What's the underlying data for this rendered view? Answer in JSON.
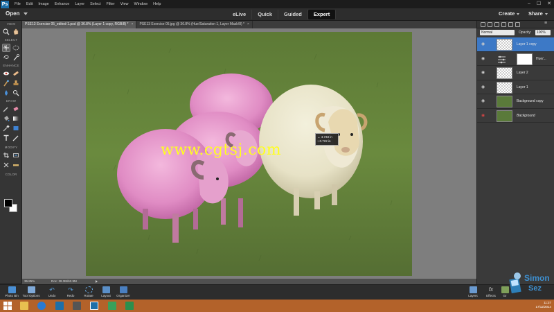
{
  "menubar": {
    "logo": "Ps",
    "items": [
      "File",
      "Edit",
      "Image",
      "Enhance",
      "Layer",
      "Select",
      "Filter",
      "View",
      "Window",
      "Help"
    ],
    "window_controls": [
      "–",
      "☐",
      "✕"
    ]
  },
  "modebar": {
    "open_label": "Open",
    "tabs": [
      "eLive",
      "Quick",
      "Guided",
      "Expert"
    ],
    "active_tab": "Expert",
    "create_label": "Create",
    "share_label": "Share"
  },
  "toolbox": {
    "sections": [
      "VIEW",
      "SELECT",
      "ENHANCE",
      "DRAW",
      "MODIFY",
      "COLOR"
    ],
    "tools": [
      "zoom",
      "hand",
      "move",
      "lasso",
      "magic-wand",
      "quick-selection",
      "eye",
      "spot-healing",
      "smart-brush",
      "blur",
      "sponge",
      "brush",
      "eraser",
      "paint-bucket",
      "gradient",
      "eyedropper",
      "rectangle",
      "type",
      "pencil",
      "crop",
      "recompose",
      "content-aware-move",
      "straighten"
    ],
    "foreground_color": "#000000",
    "background_color": "#ffffff"
  },
  "documents": {
    "tabs": [
      {
        "title": "PSE13 Exercise 05_edited-1.psd @ 36.8% (Layer 1 copy, RGB/8) *",
        "active": true
      },
      {
        "title": "PSE13 Exercise 05.jpg @ 36.8% (Hue/Saturation 1, Layer Mask/8) *",
        "active": false
      }
    ]
  },
  "canvas": {
    "watermark": "www.cgtsj.com",
    "measure_x": "↔ 4.733 in",
    "measure_y": "↕ 0.722 in"
  },
  "status": {
    "zoom": "36.85%",
    "doc": "Doc: 28.3M/62.9M"
  },
  "layers_panel": {
    "blend_mode": "Normal",
    "opacity_label": "Opacity:",
    "opacity_value": "100%",
    "layers": [
      {
        "name": "Layer 1 copy",
        "active": true
      },
      {
        "name": "Hue/...",
        "type": "adjustment"
      },
      {
        "name": "Layer 2"
      },
      {
        "name": "Layer 1"
      },
      {
        "name": "Background copy"
      },
      {
        "name": "Background",
        "italic": true
      }
    ]
  },
  "bottombar": {
    "left_items": [
      "Photo Bin",
      "Tool Options",
      "Undo",
      "Redo",
      "Rotate",
      "Layout",
      "Organizer"
    ],
    "right_items": [
      "Layers",
      "Effects",
      "Gr"
    ]
  },
  "branding": {
    "logo_text_1": "Simon",
    "logo_text_2": "Sez"
  },
  "taskbar": {
    "tray_time": "11:37",
    "tray_date": "17/12/2014"
  }
}
